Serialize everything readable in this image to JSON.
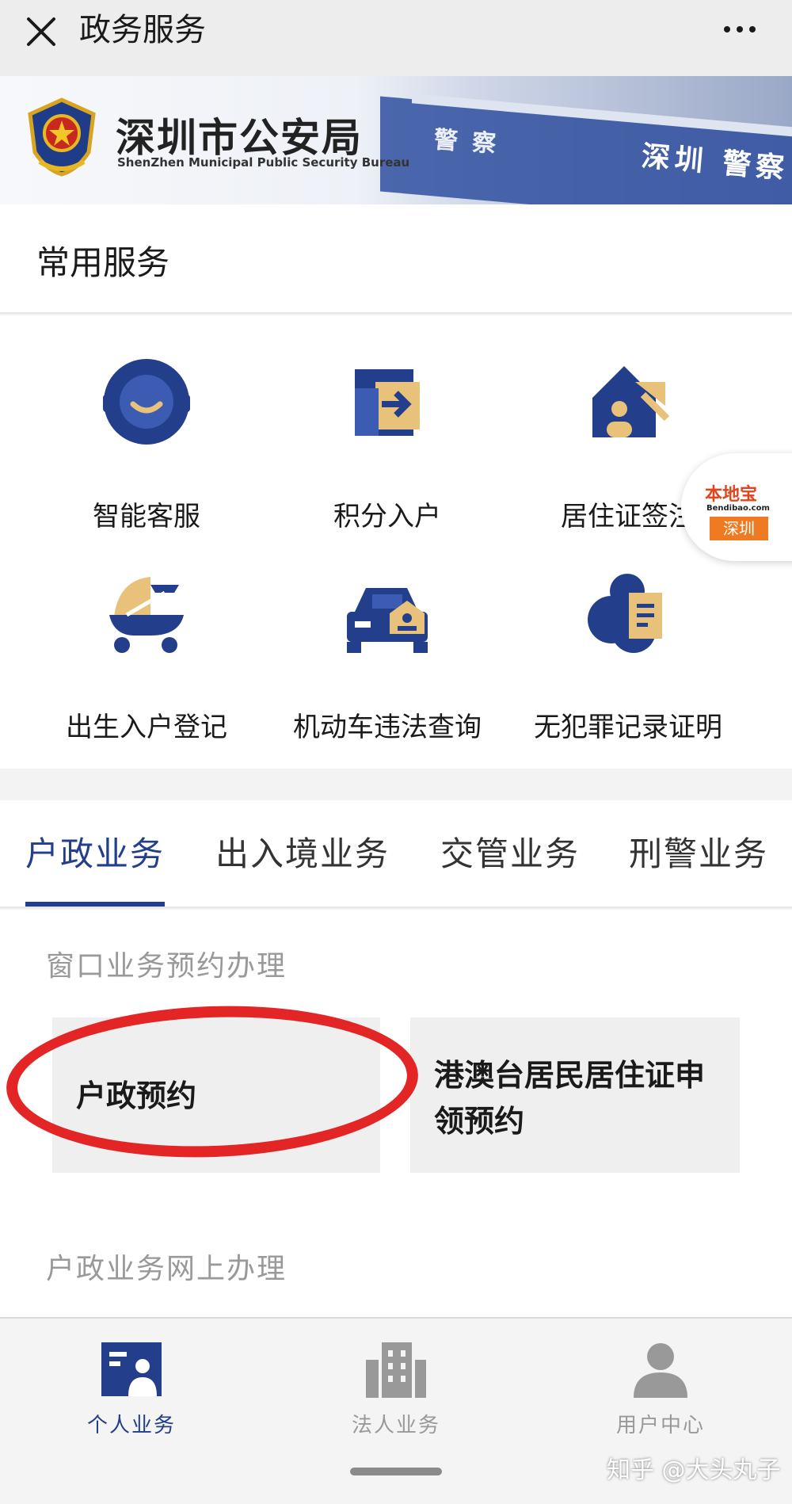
{
  "header": {
    "title": "政务服务"
  },
  "banner": {
    "bureau_cn": "深圳市公安局",
    "bureau_en": "ShenZhen Municipal Public Security Bureau",
    "sign_main": "深圳 警察",
    "sign_side": "警 察"
  },
  "common_services": {
    "heading": "常用服务",
    "items": [
      {
        "label": "智能客服",
        "icon": "smart-service-icon"
      },
      {
        "label": "积分入户",
        "icon": "points-household-icon"
      },
      {
        "label": "居住证签注",
        "icon": "residence-permit-icon"
      },
      {
        "label": "出生入户登记",
        "icon": "birth-registration-icon"
      },
      {
        "label": "机动车违法查询",
        "icon": "vehicle-violation-icon"
      },
      {
        "label": "无犯罪记录证明",
        "icon": "no-criminal-record-icon"
      }
    ]
  },
  "floating_badge": {
    "brand": "本地宝",
    "domain": "Bendibao.com",
    "city": "深圳"
  },
  "tabs": [
    {
      "label": "户政业务",
      "active": true
    },
    {
      "label": "出入境业务",
      "active": false
    },
    {
      "label": "交管业务",
      "active": false
    },
    {
      "label": "刑警业务",
      "active": false
    }
  ],
  "content": {
    "window_heading": "窗口业务预约办理",
    "cards": [
      {
        "label": "户政预约"
      },
      {
        "label": "港澳台居民居住证申领预约"
      }
    ],
    "online_heading": "户政业务网上办理"
  },
  "bottom_nav": [
    {
      "label": "个人业务",
      "active": true
    },
    {
      "label": "法人业务",
      "active": false
    },
    {
      "label": "用户中心",
      "active": false
    }
  ],
  "watermark": "知乎 @大头丸子",
  "colors": {
    "primary": "#233e8b",
    "accent_yellow": "#e8c27a",
    "highlight_red": "#e42525"
  }
}
